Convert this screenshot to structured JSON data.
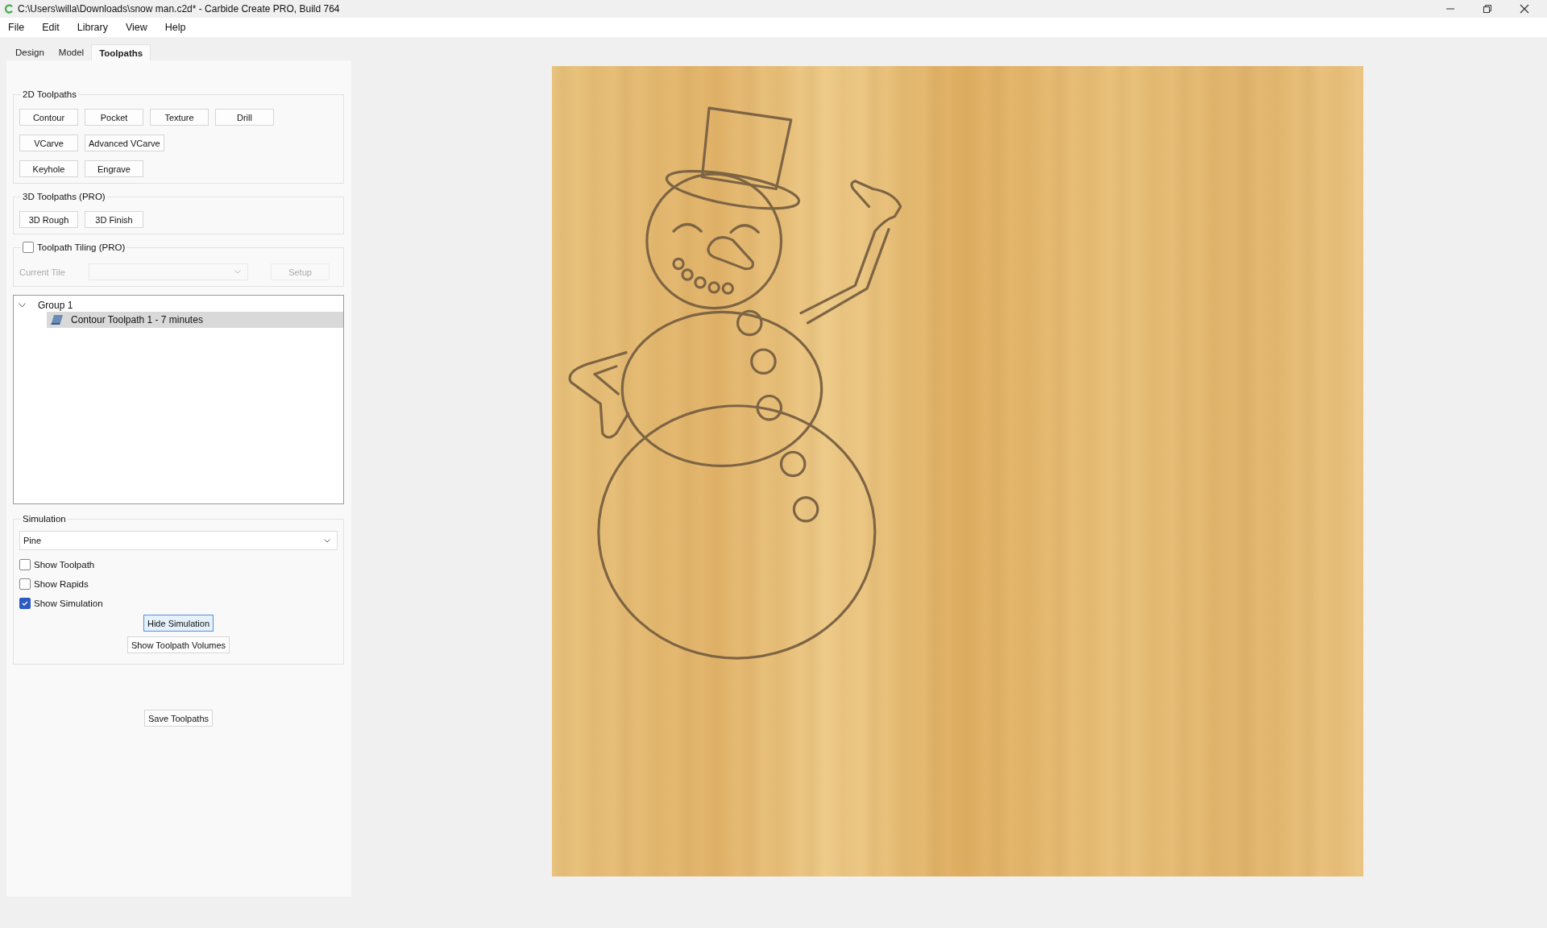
{
  "window": {
    "title": "C:\\Users\\willa\\Downloads\\snow man.c2d* - Carbide Create PRO, Build 764"
  },
  "menu": [
    "File",
    "Edit",
    "Library",
    "View",
    "Help"
  ],
  "tabs": [
    {
      "label": "Design",
      "selected": false
    },
    {
      "label": "Model",
      "selected": false
    },
    {
      "label": "Toolpaths",
      "selected": true
    }
  ],
  "toolpaths_2d": {
    "title": "2D Toolpaths",
    "rows": [
      [
        "Contour",
        "Pocket",
        "Texture",
        "Drill"
      ],
      [
        "VCarve",
        "Advanced VCarve"
      ],
      [
        "Keyhole",
        "Engrave"
      ]
    ]
  },
  "toolpaths_3d": {
    "title": "3D Toolpaths (PRO)",
    "buttons": [
      "3D Rough",
      "3D Finish"
    ]
  },
  "tiling": {
    "label": "Toolpath Tiling (PRO)",
    "checked": false,
    "current_tile_label": "Current Tile",
    "setup_button": "Setup",
    "disabled": true
  },
  "tree": [
    {
      "label": "Group 1",
      "expanded": true,
      "children": [
        {
          "label": "Contour Toolpath 1 - 7 minutes",
          "selected": true
        }
      ]
    }
  ],
  "simulation": {
    "title": "Simulation",
    "material": "Pine",
    "checkboxes": [
      {
        "label": "Show Toolpath",
        "checked": false
      },
      {
        "label": "Show Rapids",
        "checked": false
      },
      {
        "label": "Show Simulation",
        "checked": true
      }
    ],
    "buttons": [
      {
        "label": "Hide Simulation",
        "focused": true
      },
      {
        "label": "Show Toolpath Volumes",
        "focused": false
      }
    ]
  },
  "save_button": "Save Toolpaths"
}
